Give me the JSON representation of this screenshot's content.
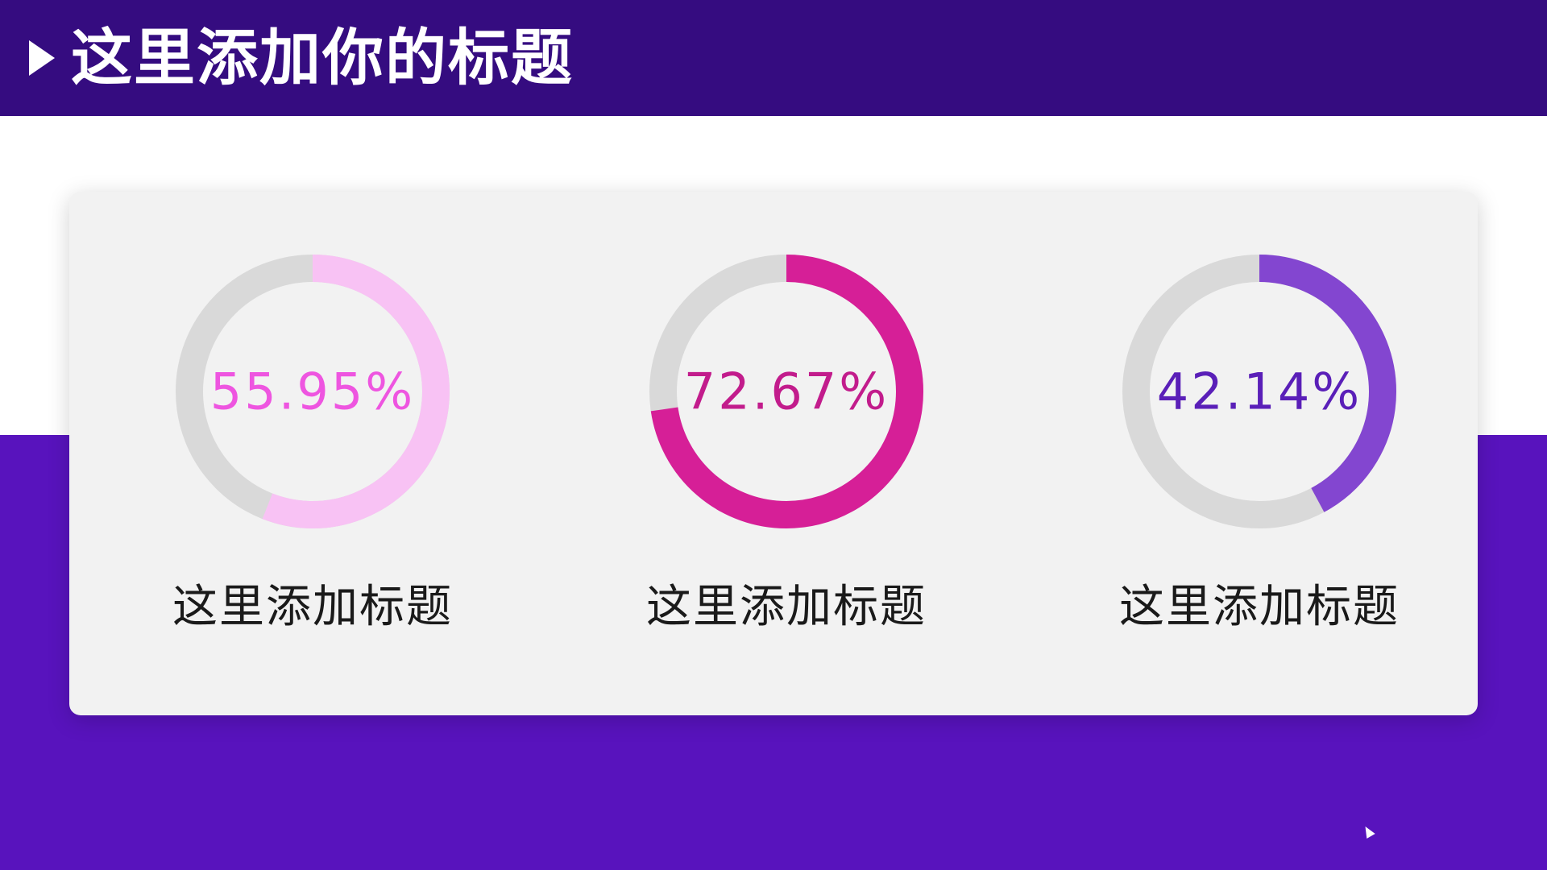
{
  "slide": {
    "title": "这里添加你的标题",
    "colors": {
      "title_bar": "#350c80",
      "bottom_band": "#5813bd",
      "card": "#f2f2f2",
      "ring_track": "#d9d9d9"
    }
  },
  "chart_data": [
    {
      "type": "pie",
      "subtype": "donut",
      "value_label": "55.95%",
      "values": [
        55.95,
        44.05
      ],
      "label": "这里添加标题",
      "color": "#f8c2f4",
      "text_color": "#ee55e0"
    },
    {
      "type": "pie",
      "subtype": "donut",
      "value_label": "72.67%",
      "values": [
        72.67,
        27.33
      ],
      "label": "这里添加标题",
      "color": "#d61f97",
      "text_color": "#c21c8c"
    },
    {
      "type": "pie",
      "subtype": "donut",
      "value_label": "42.14%",
      "values": [
        42.14,
        57.86
      ],
      "label": "这里添加标题",
      "color": "#8346d0",
      "text_color": "#5a1fb8"
    }
  ]
}
